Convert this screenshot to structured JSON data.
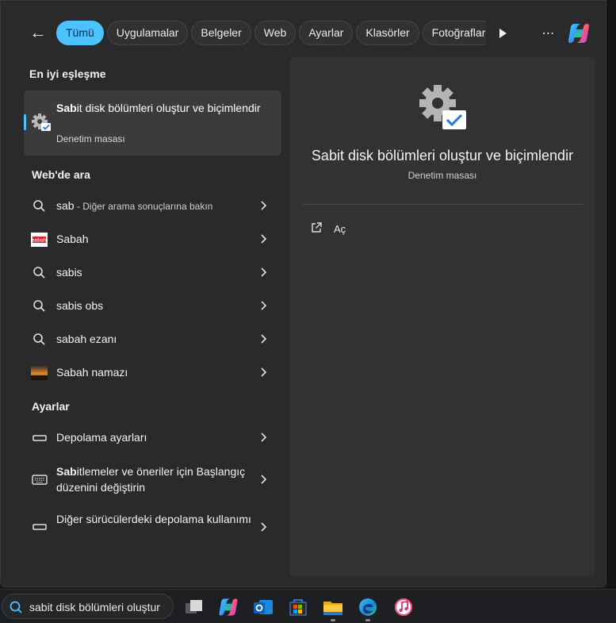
{
  "filters": {
    "back_label": "←",
    "chips": [
      "Tümü",
      "Uygulamalar",
      "Belgeler",
      "Web",
      "Ayarlar",
      "Klasörler",
      "Fotoğraflar"
    ],
    "active": "Tümü",
    "more_label": "⋯"
  },
  "best_match": {
    "heading": "En iyi eşleşme",
    "title_bold": "Sab",
    "title_rest": "it disk bölümleri oluştur ve biçimlendir",
    "subtitle": "Denetim masası",
    "icon": "settings-gear-check-icon"
  },
  "web": {
    "heading": "Web'de ara",
    "items": [
      {
        "text": "sab",
        "suffix": " - Diğer arama sonuçlarına bakın",
        "icon": "search-icon"
      },
      {
        "text": "Sabah",
        "icon": "sabah-logo-icon"
      },
      {
        "text": "sabis",
        "icon": "search-icon"
      },
      {
        "text": "sabis obs",
        "icon": "search-icon"
      },
      {
        "text": "sabah ezanı",
        "icon": "search-icon"
      },
      {
        "text": "Sabah namazı",
        "icon": "sunrise-thumbnail-icon"
      }
    ]
  },
  "settings": {
    "heading": "Ayarlar",
    "items": [
      {
        "text": "Depolama ayarları",
        "icon": "storage-icon"
      },
      {
        "text_bold": "Sab",
        "text_rest": "itlemeler ve öneriler için Başlangıç düzenini değiştirin",
        "icon": "keyboard-icon"
      },
      {
        "text": "Diğer sürücülerdeki depolama kullanımı",
        "icon": "drive-icon"
      }
    ]
  },
  "detail": {
    "title": "Sabit disk bölümleri oluştur ve biçimlendir",
    "subtitle": "Denetim masası",
    "action_open": "Aç"
  },
  "taskbar": {
    "search_value": "sabit disk bölümleri oluştur",
    "apps": [
      "task-view-icon",
      "copilot-icon",
      "outlook-icon",
      "store-icon",
      "file-explorer-icon",
      "edge-icon",
      "itunes-icon"
    ]
  },
  "colors": {
    "accent": "#4cc2ff",
    "panel": "#2a2a2c",
    "detail_panel": "#323234"
  }
}
